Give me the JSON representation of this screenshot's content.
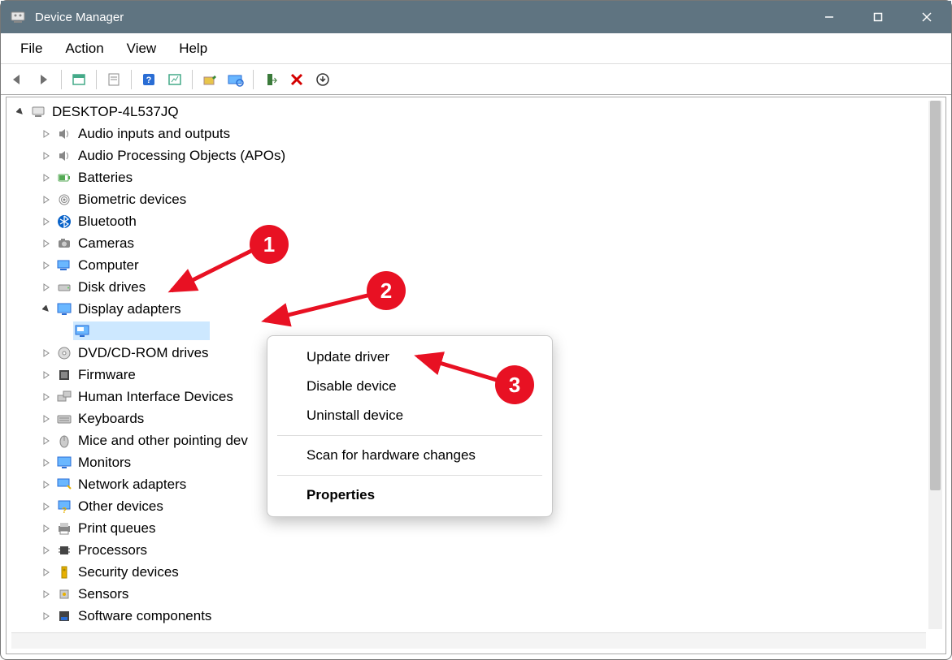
{
  "window": {
    "title": "Device Manager"
  },
  "menu": {
    "items": [
      "File",
      "Action",
      "View",
      "Help"
    ]
  },
  "toolbar": {
    "buttons": [
      "back",
      "forward",
      "show-hidden",
      "properties",
      "help",
      "details",
      "update",
      "scan",
      "enable",
      "disable",
      "uninstall"
    ]
  },
  "tree": {
    "root": "DESKTOP-4L537JQ",
    "categories": [
      {
        "label": "Audio inputs and outputs",
        "icon": "speaker",
        "expanded": false
      },
      {
        "label": "Audio Processing Objects (APOs)",
        "icon": "speaker",
        "expanded": false
      },
      {
        "label": "Batteries",
        "icon": "battery",
        "expanded": false
      },
      {
        "label": "Biometric devices",
        "icon": "fingerprint",
        "expanded": false
      },
      {
        "label": "Bluetooth",
        "icon": "bluetooth",
        "expanded": false
      },
      {
        "label": "Cameras",
        "icon": "camera",
        "expanded": false
      },
      {
        "label": "Computer",
        "icon": "computer",
        "expanded": false
      },
      {
        "label": "Disk drives",
        "icon": "disk",
        "expanded": false
      },
      {
        "label": "Display adapters",
        "icon": "display",
        "expanded": true,
        "children": [
          {
            "label": "",
            "icon": "display-card",
            "selected": true
          }
        ]
      },
      {
        "label": "DVD/CD-ROM drives",
        "icon": "dvd",
        "expanded": false
      },
      {
        "label": "Firmware",
        "icon": "firmware",
        "expanded": false
      },
      {
        "label": "Human Interface Devices",
        "icon": "hid",
        "expanded": false
      },
      {
        "label": "Keyboards",
        "icon": "keyboard",
        "expanded": false
      },
      {
        "label": "Mice and other pointing devices",
        "icon": "mouse",
        "expanded": false,
        "truncated": "Mice and other pointing dev"
      },
      {
        "label": "Monitors",
        "icon": "monitor",
        "expanded": false
      },
      {
        "label": "Network adapters",
        "icon": "network",
        "expanded": false
      },
      {
        "label": "Other devices",
        "icon": "other",
        "expanded": false
      },
      {
        "label": "Print queues",
        "icon": "printer",
        "expanded": false
      },
      {
        "label": "Processors",
        "icon": "cpu",
        "expanded": false
      },
      {
        "label": "Security devices",
        "icon": "security",
        "expanded": false
      },
      {
        "label": "Sensors",
        "icon": "sensor",
        "expanded": false
      },
      {
        "label": "Software components",
        "icon": "software",
        "expanded": false
      }
    ]
  },
  "context_menu": {
    "items": [
      {
        "label": "Update driver",
        "type": "item"
      },
      {
        "label": "Disable device",
        "type": "item"
      },
      {
        "label": "Uninstall device",
        "type": "item"
      },
      {
        "type": "sep"
      },
      {
        "label": "Scan for hardware changes",
        "type": "item"
      },
      {
        "type": "sep"
      },
      {
        "label": "Properties",
        "type": "item",
        "bold": true
      }
    ]
  },
  "annotations": {
    "badges": [
      "1",
      "2",
      "3"
    ]
  }
}
